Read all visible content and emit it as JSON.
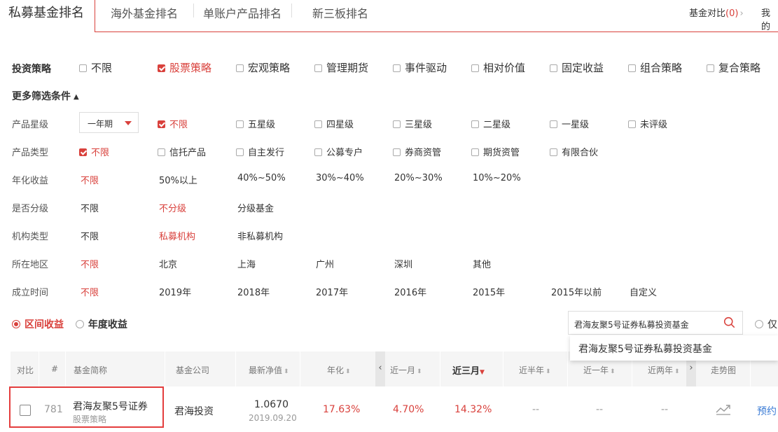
{
  "tabs": {
    "active": "私募基金排名",
    "items": [
      "海外基金排名",
      "单账户产品排名",
      "新三板排名"
    ]
  },
  "top_right": {
    "compare_label": "基金对比",
    "compare_count": "(0)",
    "mine_label": "我的"
  },
  "strategy": {
    "label": "投资策略",
    "options": [
      "不限",
      "股票策略",
      "宏观策略",
      "管理期货",
      "事件驱动",
      "相对价值",
      "固定收益",
      "组合策略",
      "复合策略"
    ],
    "selected": "股票策略"
  },
  "more_filters": {
    "label": "更多筛选条件"
  },
  "rating": {
    "label": "产品星级",
    "period": "一年期",
    "options": [
      "不限",
      "五星级",
      "四星级",
      "三星级",
      "二星级",
      "一星级",
      "未评级"
    ],
    "selected": "不限"
  },
  "product_type": {
    "label": "产品类型",
    "options": [
      "不限",
      "信托产品",
      "自主发行",
      "公募专户",
      "券商资管",
      "期货资管",
      "有限合伙"
    ],
    "selected": "不限"
  },
  "annual_return": {
    "label": "年化收益",
    "options": [
      "不限",
      "50%以上",
      "40%~50%",
      "30%~40%",
      "20%~30%",
      "10%~20%"
    ],
    "selected": "不限"
  },
  "graded": {
    "label": "是否分级",
    "options": [
      "不限",
      "不分级",
      "分级基金"
    ],
    "selected": "不分级"
  },
  "org_type": {
    "label": "机构类型",
    "options": [
      "不限",
      "私募机构",
      "非私募机构"
    ],
    "selected": "私募机构"
  },
  "region": {
    "label": "所在地区",
    "options": [
      "不限",
      "北京",
      "上海",
      "广州",
      "深圳",
      "其他"
    ],
    "selected": "不限"
  },
  "founded": {
    "label": "成立时间",
    "options": [
      "不限",
      "2019年",
      "2018年",
      "2017年",
      "2016年",
      "2015年",
      "2015年以前",
      "自定义"
    ],
    "selected": "不限"
  },
  "return_type": {
    "interval": "区间收益",
    "yearly": "年度收益",
    "selected": "区间收益"
  },
  "search": {
    "value": "君海友聚5号证券私募投资基金",
    "only_label": "仅",
    "suggestion": "君海友聚5号证券私募投资基金"
  },
  "table": {
    "headers": {
      "compare": "对比",
      "index": "#",
      "name": "基金简称",
      "company": "基金公司",
      "nav": "最新净值",
      "annual": "年化",
      "m1": "近一月",
      "m3": "近三月",
      "h1": "近半年",
      "y1": "近一年",
      "y2": "近两年",
      "trend": "走势图"
    },
    "row": {
      "rank": "781",
      "name": "君海友聚5号证券",
      "strategy": "股票策略",
      "company": "君海投资",
      "nav": "1.0670",
      "nav_date": "2019.09.20",
      "annual": "17.63%",
      "m1": "4.70%",
      "m3": "14.32%",
      "h1": "--",
      "y1": "--",
      "y2": "--",
      "action": "预约"
    }
  },
  "colors": {
    "accent": "#d9413c",
    "header_bg": "#f5f5f5"
  }
}
